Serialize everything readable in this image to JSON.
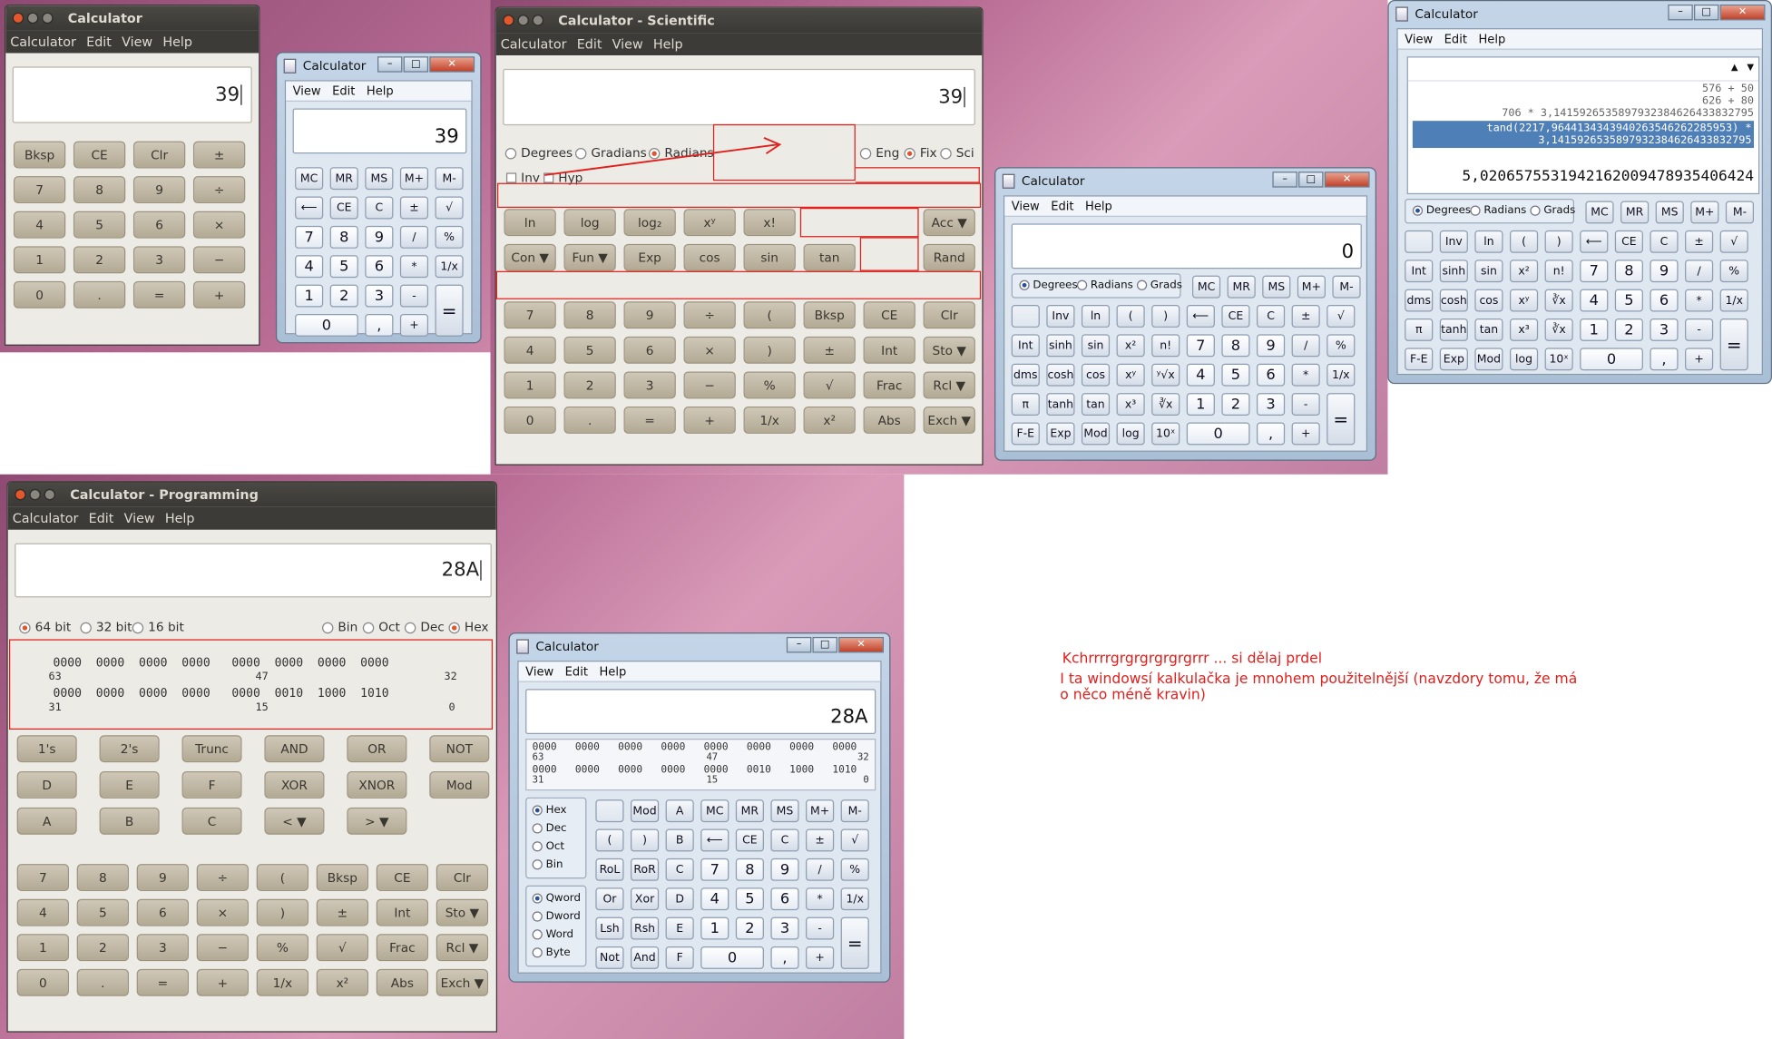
{
  "ubuntu_basic": {
    "title": "Calculator",
    "menu": [
      "Calculator",
      "Edit",
      "View",
      "Help"
    ],
    "display": "39",
    "buttons": [
      [
        "Bksp",
        "CE",
        "Clr",
        "±"
      ],
      [
        "7",
        "8",
        "9",
        "÷"
      ],
      [
        "4",
        "5",
        "6",
        "×"
      ],
      [
        "1",
        "2",
        "3",
        "−"
      ],
      [
        "0",
        ".",
        "=",
        "+"
      ]
    ]
  },
  "win_small": {
    "title": "Calculator",
    "menu": [
      "View",
      "Edit",
      "Help"
    ],
    "display": "39",
    "buttons": [
      [
        "MC",
        "MR",
        "MS",
        "M+",
        "M-"
      ],
      [
        "⟵",
        "CE",
        "C",
        "±",
        "√"
      ],
      [
        "7",
        "8",
        "9",
        "/",
        "%"
      ],
      [
        "4",
        "5",
        "6",
        "*",
        "1/x"
      ],
      [
        "1",
        "2",
        "3",
        "-"
      ],
      [
        "0",
        ",",
        "+"
      ]
    ],
    "equals": "="
  },
  "ubuntu_sci": {
    "title": "Calculator - Scientific",
    "menu": [
      "Calculator",
      "Edit",
      "View",
      "Help"
    ],
    "display": "39",
    "angle": [
      "Degrees",
      "Gradians",
      "Radians"
    ],
    "format": [
      "Eng",
      "Fix",
      "Sci"
    ],
    "inv": "Inv",
    "hyp": "Hyp",
    "row1": [
      "ln",
      "log",
      "log₂",
      "xʸ",
      "x!",
      "",
      "",
      "Acc ▼"
    ],
    "row2": [
      "Con ▼",
      "Fun ▼",
      "Exp",
      "cos",
      "sin",
      "tan",
      "",
      "Rand"
    ],
    "buttons": [
      [
        "7",
        "8",
        "9",
        "÷",
        "(",
        "Bksp",
        "CE",
        "Clr"
      ],
      [
        "4",
        "5",
        "6",
        "×",
        ")",
        "±",
        "Int",
        "Sto ▼"
      ],
      [
        "1",
        "2",
        "3",
        "−",
        "%",
        "√",
        "Frac",
        "Rcl ▼"
      ],
      [
        "0",
        ".",
        "=",
        "+",
        "1/x",
        "x²",
        "Abs",
        "Exch ▼"
      ]
    ]
  },
  "win_sci": {
    "title": "Calculator",
    "menu": [
      "View",
      "Edit",
      "Help"
    ],
    "display": "0",
    "angle": [
      "Degrees",
      "Radians",
      "Grads"
    ],
    "top": [
      "MC",
      "MR",
      "MS",
      "M+",
      "M-"
    ],
    "rows": [
      [
        "",
        "Inv",
        "ln",
        "(",
        ")",
        "⟵",
        "CE",
        "C",
        "±",
        "√"
      ],
      [
        "Int",
        "sinh",
        "sin",
        "x²",
        "n!",
        "7",
        "8",
        "9",
        "/",
        "%"
      ],
      [
        "dms",
        "cosh",
        "cos",
        "xʸ",
        "ʸ√x",
        "4",
        "5",
        "6",
        "*",
        "1/x"
      ],
      [
        "π",
        "tanh",
        "tan",
        "x³",
        "∛x",
        "1",
        "2",
        "3",
        "-"
      ],
      [
        "F-E",
        "Exp",
        "Mod",
        "log",
        "10ˣ",
        "0",
        ",",
        "+"
      ]
    ],
    "equals": "="
  },
  "win_hist": {
    "title": "Calculator",
    "menu": [
      "View",
      "Edit",
      "Help"
    ],
    "history": [
      "576 + 50",
      "626 + 80",
      "706 * 3,1415926535897932384626433832795"
    ],
    "selected": [
      "tand(2217,9644134343940263546262285953) *",
      "3,1415926535897932384626433832795"
    ],
    "result": "5,0206575531942162009478935406424",
    "angle": [
      "Degrees",
      "Radians",
      "Grads"
    ],
    "top": [
      "MC",
      "MR",
      "MS",
      "M+",
      "M-"
    ],
    "rows": [
      [
        "",
        "Inv",
        "ln",
        "(",
        ")",
        "⟵",
        "CE",
        "C",
        "±",
        "√"
      ],
      [
        "Int",
        "sinh",
        "sin",
        "x²",
        "n!",
        "7",
        "8",
        "9",
        "/",
        "%"
      ],
      [
        "dms",
        "cosh",
        "cos",
        "xʸ",
        "∛x",
        "4",
        "5",
        "6",
        "*",
        "1/x"
      ],
      [
        "π",
        "tanh",
        "tan",
        "x³",
        "∛x",
        "1",
        "2",
        "3",
        "-"
      ],
      [
        "F-E",
        "Exp",
        "Mod",
        "log",
        "10ˣ",
        "0",
        ",",
        "+"
      ]
    ],
    "equals": "="
  },
  "ubuntu_prog": {
    "title": "Calculator - Programming",
    "menu": [
      "Calculator",
      "Edit",
      "View",
      "Help"
    ],
    "display": "28A",
    "bits": [
      "64 bit",
      "32 bit",
      "16 bit"
    ],
    "bases": [
      "Bin",
      "Oct",
      "Dec",
      "Hex"
    ],
    "bitrow1": "0000  0000  0000  0000   0000  0000  0000  0000",
    "bitlab1": [
      "63",
      "47",
      "32"
    ],
    "bitrow2": "0000  0000  0000  0000   0000  0010  1000  1010",
    "bitlab2": [
      "31",
      "15",
      "0"
    ],
    "logic": [
      [
        "1's",
        "2's",
        "Trunc",
        "AND",
        "OR",
        "NOT"
      ],
      [
        "D",
        "E",
        "F",
        "XOR",
        "XNOR",
        "Mod"
      ],
      [
        "A",
        "B",
        "C",
        "< ▼",
        "> ▼"
      ]
    ],
    "buttons": [
      [
        "7",
        "8",
        "9",
        "÷",
        "(",
        "Bksp",
        "CE",
        "Clr"
      ],
      [
        "4",
        "5",
        "6",
        "×",
        ")",
        "±",
        "Int",
        "Sto ▼"
      ],
      [
        "1",
        "2",
        "3",
        "−",
        "%",
        "√",
        "Frac",
        "Rcl ▼"
      ],
      [
        "0",
        ".",
        "=",
        "+",
        "1/x",
        "x²",
        "Abs",
        "Exch ▼"
      ]
    ]
  },
  "win_prog": {
    "title": "Calculator",
    "menu": [
      "View",
      "Edit",
      "Help"
    ],
    "display": "28A",
    "bitline1": "0000   0000   0000   0000   0000   0000   0000   0000",
    "bitlab1": [
      "63",
      "47",
      "32"
    ],
    "bitline2": "0000   0000   0000   0000   0000   0010   1000   1010",
    "bitlab2": [
      "31",
      "15",
      "0"
    ],
    "bases": [
      "Hex",
      "Dec",
      "Oct",
      "Bin"
    ],
    "words": [
      "Qword",
      "Dword",
      "Word",
      "Byte"
    ],
    "rows": [
      [
        "",
        "Mod",
        "A",
        "MC",
        "MR",
        "MS",
        "M+",
        "M-"
      ],
      [
        "(",
        ")",
        "B",
        "⟵",
        "CE",
        "C",
        "±",
        "√"
      ],
      [
        "RoL",
        "RoR",
        "C",
        "7",
        "8",
        "9",
        "/",
        "%"
      ],
      [
        "Or",
        "Xor",
        "D",
        "4",
        "5",
        "6",
        "*",
        "1/x"
      ],
      [
        "Lsh",
        "Rsh",
        "E",
        "1",
        "2",
        "3",
        "-"
      ],
      [
        "Not",
        "And",
        "F",
        "0",
        ",",
        "+"
      ]
    ],
    "equals": "="
  },
  "note": {
    "line1": "Kchrrrrgrgrgrgrgrgrrr ... si dělaj prdel",
    "line2": "I ta windowsí kalkulačka je mnohem použitelnější (navzdory tomu, že má",
    "line3": "o něco méně kravin)"
  }
}
